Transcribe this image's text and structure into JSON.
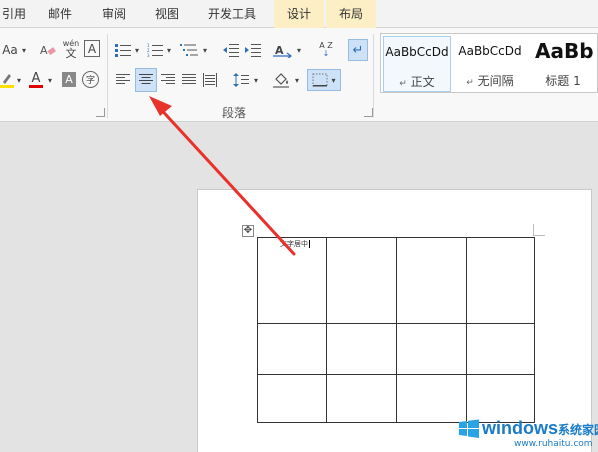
{
  "tabs": [
    {
      "label": "引用",
      "highlighted": false
    },
    {
      "label": "邮件",
      "highlighted": false
    },
    {
      "label": "审阅",
      "highlighted": false
    },
    {
      "label": "视图",
      "highlighted": false
    },
    {
      "label": "开发工具",
      "highlighted": false
    },
    {
      "label": "设计",
      "highlighted": true
    },
    {
      "label": "布局",
      "highlighted": true
    }
  ],
  "font_group": {
    "change_case": "Aa",
    "phonetic_top": "wén",
    "phonetic_bottom": "文",
    "char_border": "A",
    "font_color": "A",
    "char_shading": "A",
    "enclose_char": "字",
    "font_color_hex": "#e00000",
    "highlight_hex": "#ffe000"
  },
  "paragraph_group": {
    "label": "段落",
    "selected_alignment": "center",
    "sort_label": "A Z"
  },
  "styles": [
    {
      "preview": "AaBbCcDd",
      "name": "正文",
      "prefix": "↵",
      "active": true
    },
    {
      "preview": "AaBbCcDd",
      "name": "无间隔",
      "prefix": "↵",
      "active": false
    },
    {
      "preview": "AaBb",
      "name": "标题 1",
      "prefix": "",
      "active": false
    }
  ],
  "document": {
    "cell_text": "文字居中",
    "table_rows": 3,
    "table_cols": 4
  },
  "watermark": {
    "brand": "windows",
    "suffix": "系统家园",
    "url": "www.ruhaitu.com"
  },
  "colors": {
    "accent_selected": "#cde2f7",
    "annotation_arrow": "#e8322c"
  }
}
